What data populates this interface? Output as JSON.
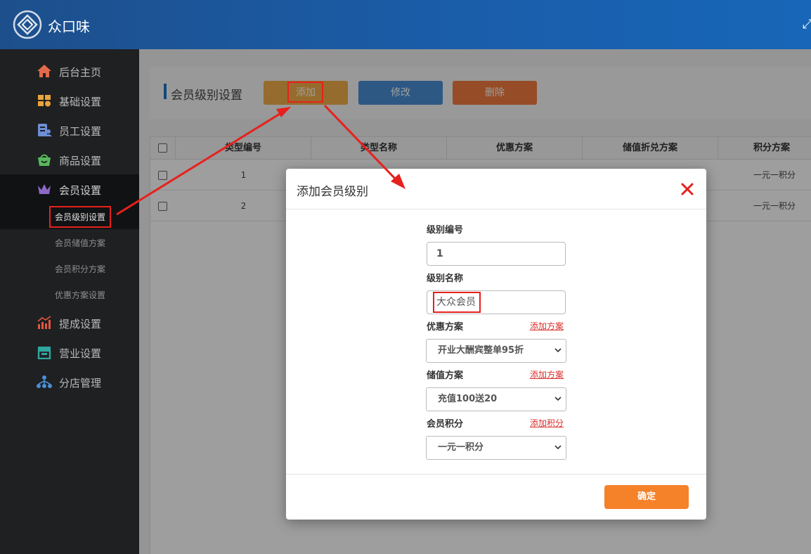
{
  "app": {
    "brand": "众口味",
    "logo_icon": "diamond-logo-icon",
    "expand_icon": "expand-icon"
  },
  "sidebar": {
    "items": [
      {
        "label": "后台主页",
        "icon": "home-icon"
      },
      {
        "label": "基础设置",
        "icon": "blocks-icon"
      },
      {
        "label": "员工设置",
        "icon": "staff-icon"
      },
      {
        "label": "商品设置",
        "icon": "basket-icon"
      },
      {
        "label": "会员设置",
        "icon": "crown-icon"
      },
      {
        "label": "提成设置",
        "icon": "chart-icon"
      },
      {
        "label": "营业设置",
        "icon": "store-icon"
      },
      {
        "label": "分店管理",
        "icon": "branch-icon"
      }
    ],
    "subitems": [
      {
        "label": "会员级别设置"
      },
      {
        "label": "会员储值方案"
      },
      {
        "label": "会员积分方案"
      },
      {
        "label": "优惠方案设置"
      }
    ]
  },
  "page": {
    "title": "会员级别设置",
    "buttons": {
      "add": "添加",
      "edit": "修改",
      "delete": "删除"
    }
  },
  "table": {
    "headers": [
      "类型编号",
      "类型名称",
      "优惠方案",
      "储值折兑方案",
      "积分方案"
    ],
    "rows": [
      {
        "id": "1",
        "points": "一元一积分"
      },
      {
        "id": "2",
        "points": "一元一积分"
      }
    ]
  },
  "modal": {
    "title": "添加会员级别",
    "fields": {
      "level_no": {
        "label": "级别编号",
        "value": "1"
      },
      "level_name": {
        "label": "级别名称",
        "value": "大众会员"
      },
      "discount": {
        "label": "优惠方案",
        "link": "添加方案",
        "value": "开业大酬宾整单95折"
      },
      "stored_value": {
        "label": "储值方案",
        "link": "添加方案",
        "value": "充值100送20"
      },
      "points": {
        "label": "会员积分",
        "link": "添加积分",
        "value": "一元一积分"
      }
    },
    "confirm": "确定"
  },
  "colors": {
    "accent": "#1a5eab",
    "add_button": "#f0ae4a",
    "edit_button": "#4a8fd6",
    "delete_button": "#f37b3e",
    "confirm_button": "#f58129",
    "annotation": "#e6211d"
  }
}
